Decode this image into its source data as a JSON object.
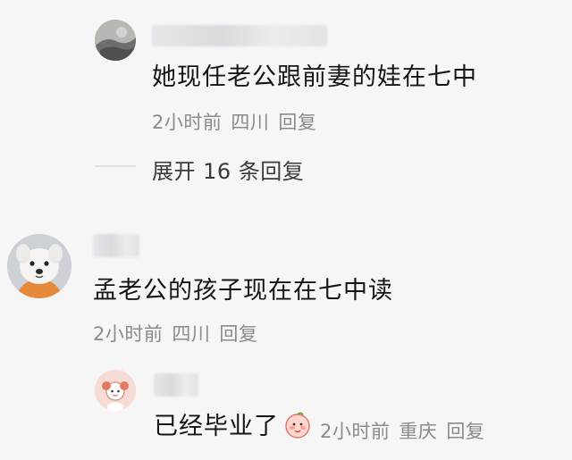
{
  "comments": [
    {
      "text": "她现任老公跟前妻的娃在七中",
      "time": "2小时前",
      "location": "四川",
      "reply_label": "回复",
      "avatar_icon": "rock-avatar-icon"
    },
    {
      "text": "孟老公的孩子现在在七中读",
      "time": "2小时前",
      "location": "四川",
      "reply_label": "回复",
      "avatar_icon": "dog-avatar-icon"
    }
  ],
  "expand_replies": "展开 16 条回复",
  "reply": {
    "text": "已经毕业了",
    "time": "2小时前",
    "location": "重庆",
    "reply_label": "回复",
    "avatar_icon": "cartoon-girl-avatar-icon",
    "emoji_icon": "peach-emoji-icon"
  }
}
